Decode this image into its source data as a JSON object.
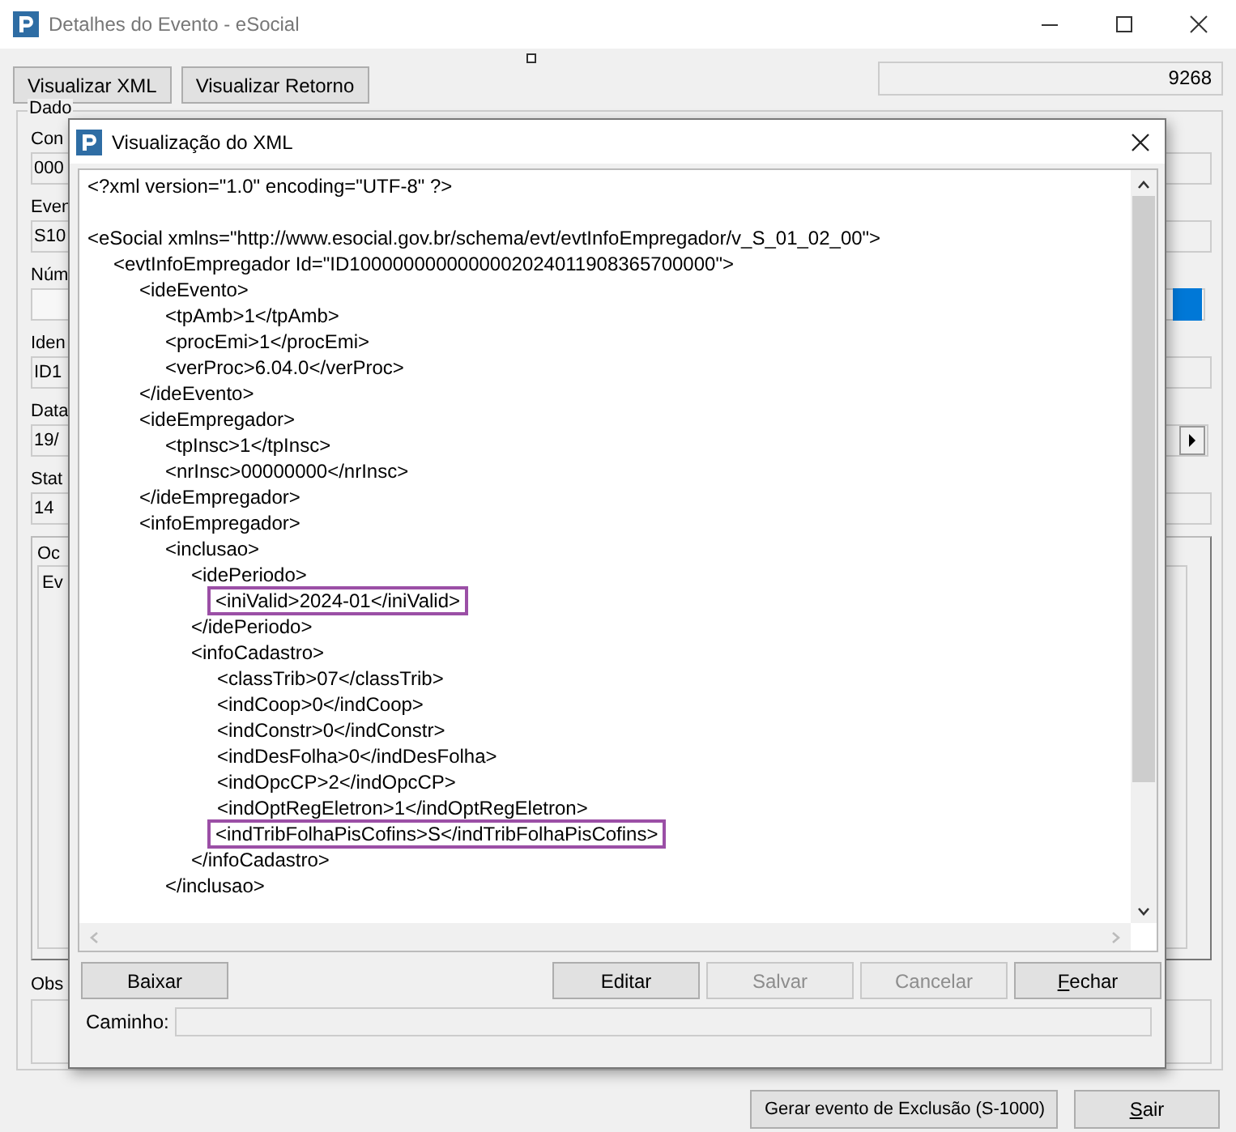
{
  "window": {
    "title": "Detalhes do Evento - eSocial"
  },
  "toolbar": {
    "buttons": [
      {
        "label": "Visualizar XML"
      },
      {
        "label": "Visualizar Retorno"
      }
    ],
    "counter": "9268"
  },
  "group": {
    "legend": "Dado",
    "fields": [
      {
        "label": "Con",
        "value": "000"
      },
      {
        "label": "Even",
        "value": "S10"
      },
      {
        "label": "Núm"
      },
      {
        "label": "Iden",
        "value": "ID1"
      },
      {
        "label": "Data",
        "value": "19/"
      },
      {
        "label": "Stat",
        "value": "14"
      }
    ],
    "occurrences": {
      "legend": "Oc",
      "item": "Ev"
    },
    "observation": {
      "label": "Obs"
    }
  },
  "footer_buttons": [
    {
      "label": "Gerar evento de Exclusão (S-1000)",
      "underline_first": false
    },
    {
      "label": "Sair",
      "underline_first": true
    }
  ],
  "dialog": {
    "title": "Visualização do XML",
    "xml_lines": [
      {
        "text": "<?xml version=\"1.0\" encoding=\"UTF-8\" ?>",
        "highlighted": false
      },
      {
        "text": "<eSocial xmlns=\"http://www.esocial.gov.br/schema/evt/evtInfoEmpregador/v_S_01_02_00\">",
        "highlighted": false,
        "blank_line_before": true,
        "children": [
          {
            "text": "<evtInfoEmpregador Id=\"ID1000000000000002024011908365700000\">",
            "highlighted": false,
            "children": [
              {
                "text": "<ideEvento>",
                "highlighted": false,
                "children": [
                  {
                    "text": "<tpAmb>1</tpAmb>",
                    "highlighted": false
                  },
                  {
                    "text": "<procEmi>1</procEmi>",
                    "highlighted": false
                  },
                  {
                    "text": "<verProc>6.04.0</verProc>",
                    "highlighted": false
                  }
                ]
              },
              {
                "text": "</ideEvento>",
                "highlighted": false
              },
              {
                "text": "<ideEmpregador>",
                "highlighted": false,
                "children": [
                  {
                    "text": "<tpInsc>1</tpInsc>",
                    "highlighted": false
                  },
                  {
                    "text": "<nrInsc>00000000</nrInsc>",
                    "highlighted": false
                  }
                ]
              },
              {
                "text": "</ideEmpregador>",
                "highlighted": false
              },
              {
                "text": "<infoEmpregador>",
                "highlighted": false,
                "children": [
                  {
                    "text": "<inclusao>",
                    "highlighted": false,
                    "children": [
                      {
                        "text": "<idePeriodo>",
                        "highlighted": false,
                        "children": [
                          {
                            "text": "<iniValid>2024-01</iniValid>",
                            "highlighted": true
                          }
                        ]
                      },
                      {
                        "text": "</idePeriodo>",
                        "highlighted": false
                      },
                      {
                        "text": "<infoCadastro>",
                        "highlighted": false,
                        "children": [
                          {
                            "text": "<classTrib>07</classTrib>",
                            "highlighted": false
                          },
                          {
                            "text": "<indCoop>0</indCoop>",
                            "highlighted": false
                          },
                          {
                            "text": "<indConstr>0</indConstr>",
                            "highlighted": false
                          },
                          {
                            "text": "<indDesFolha>0</indDesFolha>",
                            "highlighted": false
                          },
                          {
                            "text": "<indOpcCP>2</indOpcCP>",
                            "highlighted": false
                          },
                          {
                            "text": "<indOptRegEletron>1</indOptRegEletron>",
                            "highlighted": false
                          },
                          {
                            "text": "<indTribFolhaPisCofins>S</indTribFolhaPisCofins>",
                            "highlighted": true
                          }
                        ]
                      },
                      {
                        "text": "</infoCadastro>",
                        "highlighted": false
                      }
                    ]
                  },
                  {
                    "text": "</inclusao>",
                    "highlighted": false
                  }
                ]
              }
            ]
          }
        ]
      }
    ],
    "buttons": [
      {
        "label": "Baixar",
        "disabled": false,
        "underline_first": false
      },
      {
        "label": "Editar",
        "disabled": false,
        "underline_first": false
      },
      {
        "label": "Salvar",
        "disabled": true,
        "underline_first": false
      },
      {
        "label": "Cancelar",
        "disabled": true,
        "underline_first": false
      },
      {
        "label": "Fechar",
        "disabled": false,
        "underline_first": true
      }
    ],
    "path_label": "Caminho:"
  }
}
